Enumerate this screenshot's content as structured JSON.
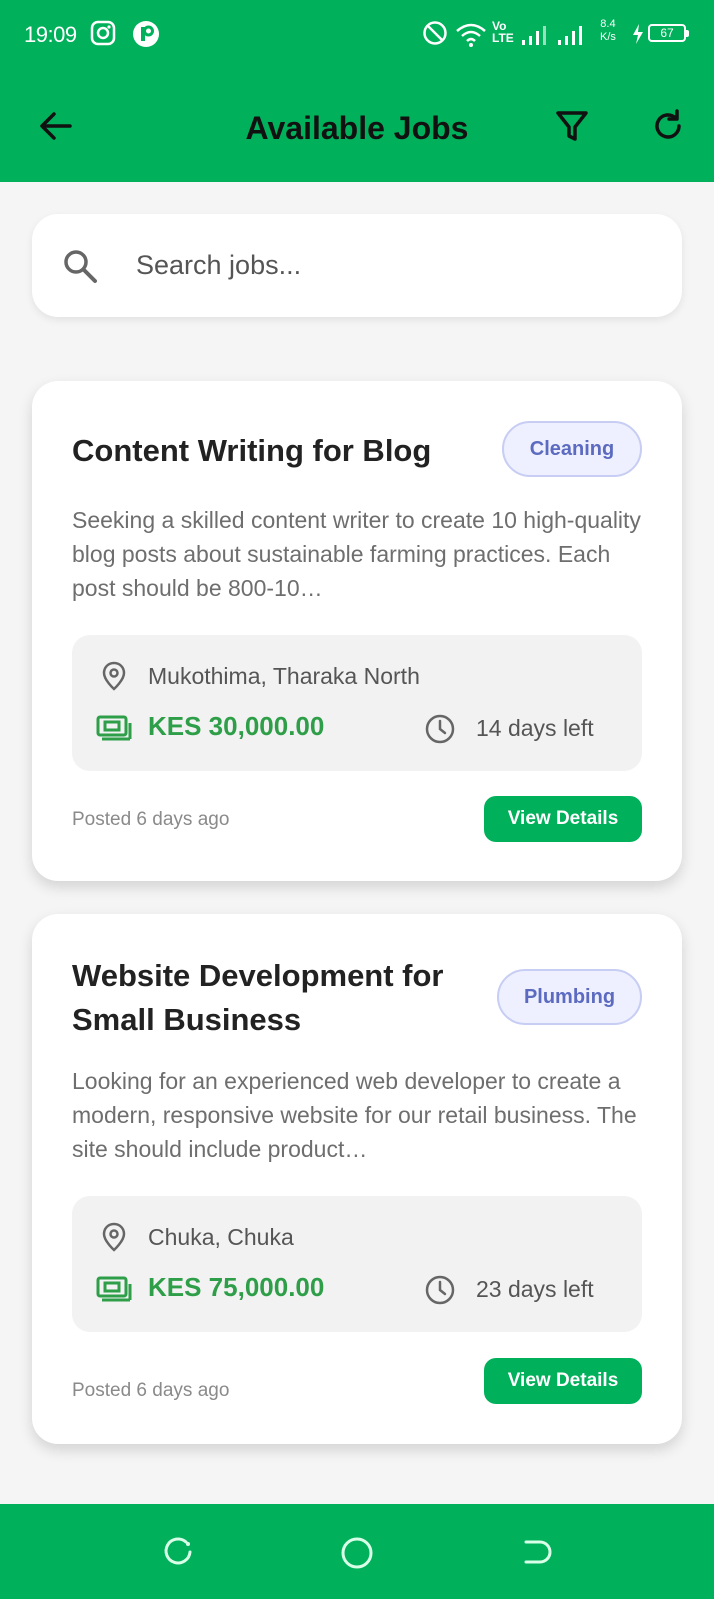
{
  "status_bar": {
    "time": "19:09",
    "network_type": "Vo\nLTE",
    "net_speed_value": "8.4",
    "net_speed_unit": "K/s",
    "battery": "67"
  },
  "header": {
    "title": "Available Jobs",
    "icons": [
      "back-arrow-icon",
      "filter-icon",
      "refresh-icon"
    ]
  },
  "search": {
    "placeholder": "Search jobs..."
  },
  "jobs": [
    {
      "title": "Content Writing for Blog",
      "category": "Cleaning",
      "description": "Seeking a skilled content writer to create 10 high-quality blog posts about sustainable farming practices. Each post should be 800-10…",
      "location": "Mukothima, Tharaka North",
      "price": "KES 30,000.00",
      "deadline": "14 days left",
      "posted": "Posted 6 days ago",
      "action": "View Details"
    },
    {
      "title": "Website Development for Small Business",
      "category": "Plumbing",
      "description": "Looking for an experienced web developer to create a modern, responsive website for our retail business. The site should include product…",
      "location": "Chuka, Chuka",
      "price": "KES 75,000.00",
      "deadline": "23 days left",
      "posted": "Posted 6 days ago",
      "action": "View Details"
    }
  ],
  "colors": {
    "primary": "#00b05a",
    "price": "#2e9e48",
    "badge_text": "#5c6bc0",
    "badge_bg": "#eef0ff"
  }
}
